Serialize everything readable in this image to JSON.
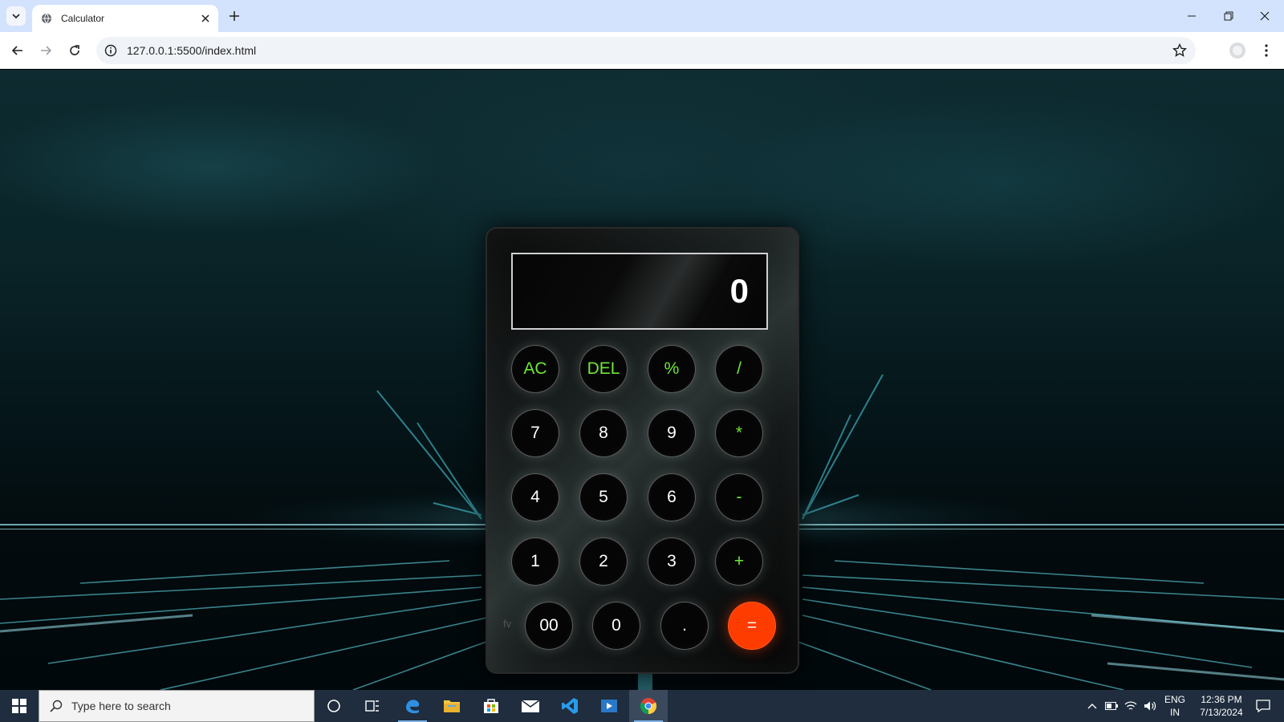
{
  "browser": {
    "tab_title": "Calculator",
    "url": "127.0.0.1:5500/index.html"
  },
  "calculator": {
    "display_value": "0",
    "corner_text": "fv",
    "rows": [
      [
        {
          "label": "AC",
          "type": "op"
        },
        {
          "label": "DEL",
          "type": "op"
        },
        {
          "label": "%",
          "type": "op"
        },
        {
          "label": "/",
          "type": "op"
        }
      ],
      [
        {
          "label": "7",
          "type": "num"
        },
        {
          "label": "8",
          "type": "num"
        },
        {
          "label": "9",
          "type": "num"
        },
        {
          "label": "*",
          "type": "op"
        }
      ],
      [
        {
          "label": "4",
          "type": "num"
        },
        {
          "label": "5",
          "type": "num"
        },
        {
          "label": "6",
          "type": "num"
        },
        {
          "label": "-",
          "type": "op"
        }
      ],
      [
        {
          "label": "1",
          "type": "num"
        },
        {
          "label": "2",
          "type": "num"
        },
        {
          "label": "3",
          "type": "num"
        },
        {
          "label": "+",
          "type": "op"
        }
      ],
      [
        {
          "label": "00",
          "type": "num"
        },
        {
          "label": "0",
          "type": "num"
        },
        {
          "label": ".",
          "type": "num"
        },
        {
          "label": "=",
          "type": "equal"
        }
      ]
    ],
    "colors": {
      "operator_text": "#6de83a",
      "equal_button": "#ff3c00",
      "number_text": "#ffffff"
    }
  },
  "taskbar": {
    "search_placeholder": "Type here to search",
    "language": "ENG",
    "region": "IN",
    "time": "12:36 PM",
    "date": "7/13/2024",
    "pinned_icons": [
      "task-view-icon",
      "edge-icon",
      "file-explorer-icon",
      "store-icon",
      "mail-icon",
      "vscode-icon",
      "media-icon",
      "chrome-icon"
    ]
  }
}
